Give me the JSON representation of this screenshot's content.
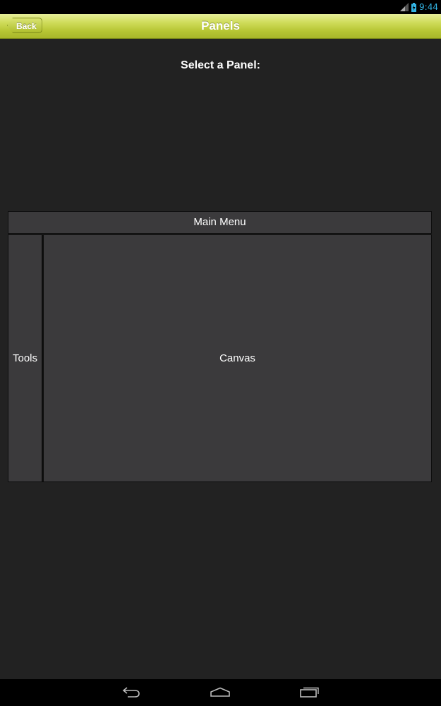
{
  "status_bar": {
    "time": "9:44",
    "icons": [
      "signal-icon",
      "battery-icon"
    ],
    "time_color": "#33b5e5"
  },
  "action_bar": {
    "back_label": "Back",
    "title": "Panels",
    "colors": {
      "top": "#e6ee9a",
      "bottom": "#a8b62a"
    }
  },
  "main": {
    "prompt": "Select a Panel:",
    "panels": {
      "main_menu": "Main Menu",
      "tools": "Tools",
      "canvas": "Canvas"
    },
    "panel_color": "#3b3a3c",
    "background_color": "#222222"
  },
  "nav_bar": {
    "icons": [
      "nav-back-icon",
      "nav-home-icon",
      "nav-recent-apps-icon"
    ]
  }
}
